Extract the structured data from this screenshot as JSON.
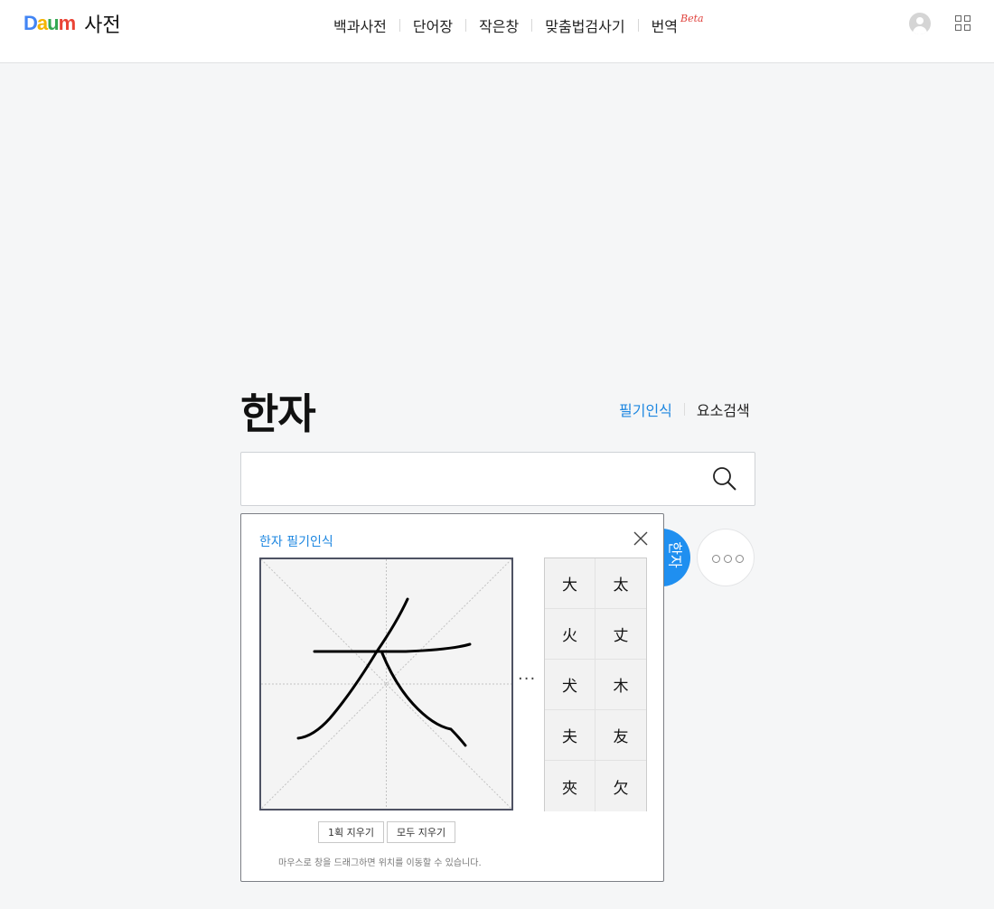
{
  "header": {
    "logo_text": "Daum",
    "service_name": "사전",
    "nav": [
      {
        "label": "백과사전"
      },
      {
        "label": "단어장"
      },
      {
        "label": "작은창"
      },
      {
        "label": "맞춤법검사기"
      },
      {
        "label": "번역",
        "badge": "Beta"
      }
    ],
    "icons": {
      "user": "user-icon",
      "apps": "apps-grid-icon"
    }
  },
  "main": {
    "title": "한자",
    "sub_links": [
      {
        "label": "필기인식",
        "active": true
      },
      {
        "label": "요소검색",
        "active": false
      }
    ],
    "search": {
      "value": "",
      "placeholder": "",
      "icon": "search-icon"
    },
    "blue_button_label": "한자",
    "more_button_icon": "more-dots-icon"
  },
  "handwriting": {
    "title": "한자 필기인식",
    "close_icon": "close-icon",
    "ellipsis": "···",
    "candidates": [
      "大",
      "太",
      "火",
      "丈",
      "犬",
      "木",
      "夫",
      "友",
      "夾",
      "欠"
    ],
    "buttons": {
      "undo_stroke": "1획 지우기",
      "clear_all": "모두 지우기"
    },
    "note": "마우스로 창을 드래그하면 위치를 이동할 수 있습니다."
  },
  "colors": {
    "accent": "#1e87e0",
    "blue_button": "#1f8ff0",
    "beta": "#e0443f",
    "background": "#f5f6f7"
  }
}
